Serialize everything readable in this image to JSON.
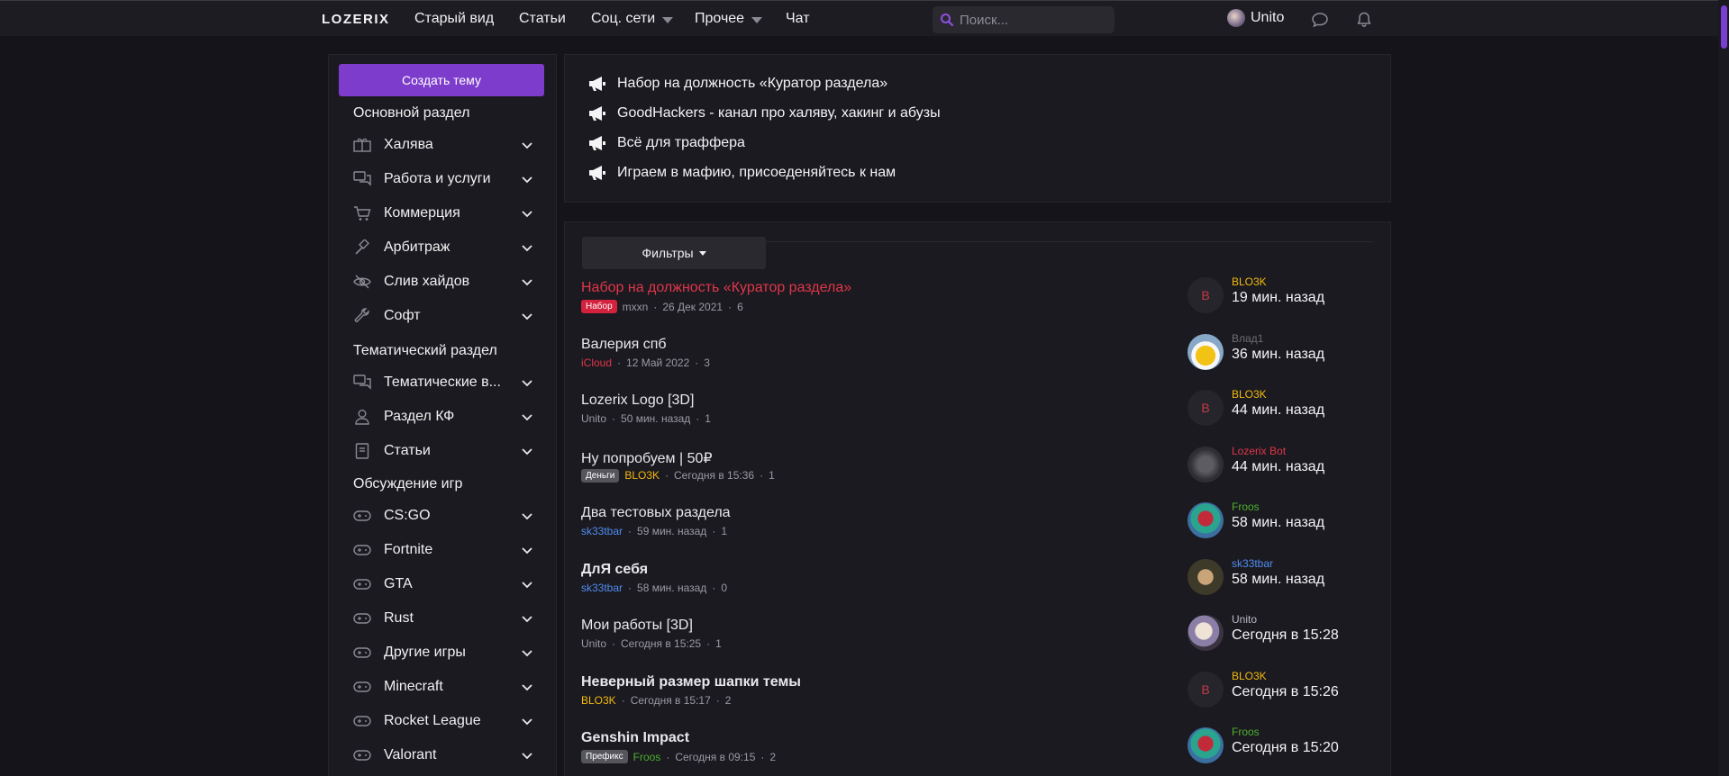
{
  "topnav": {
    "logo": "LOZERIX",
    "links": [
      "Старый вид",
      "Статьи",
      "Соц. сети",
      "Прочее",
      "Чат"
    ],
    "search_placeholder": "Поиск...",
    "username": "Unito"
  },
  "sidebar": {
    "create_button": "Создать тему",
    "sections": [
      {
        "title": "Основной раздел",
        "items": [
          {
            "label": "Халява",
            "icon": "gift-icon"
          },
          {
            "label": "Работа и услуги",
            "icon": "chat-icon"
          },
          {
            "label": "Коммерция",
            "icon": "cart-icon"
          },
          {
            "label": "Арбитраж",
            "icon": "hammer-icon"
          },
          {
            "label": "Слив хайдов",
            "icon": "eye-slash-icon"
          },
          {
            "label": "Софт",
            "icon": "wrench-icon"
          }
        ]
      },
      {
        "title": "Тематический раздел",
        "items": [
          {
            "label": "Тематические в...",
            "icon": "chat-icon"
          },
          {
            "label": "Раздел КФ",
            "icon": "user-icon"
          },
          {
            "label": "Статьи",
            "icon": "book-icon"
          }
        ]
      },
      {
        "title": "Обсуждение игр",
        "items": [
          {
            "label": "CS:GO",
            "icon": "gamepad-icon"
          },
          {
            "label": "Fortnite",
            "icon": "gamepad-icon"
          },
          {
            "label": "GTA",
            "icon": "gamepad-icon"
          },
          {
            "label": "Rust",
            "icon": "gamepad-icon"
          },
          {
            "label": "Другие игры",
            "icon": "gamepad-icon"
          },
          {
            "label": "Minecraft",
            "icon": "gamepad-icon"
          },
          {
            "label": "Rocket League",
            "icon": "gamepad-icon"
          },
          {
            "label": "Valorant",
            "icon": "gamepad-icon"
          }
        ]
      }
    ]
  },
  "announcements": [
    "Набор на должность «Куратор раздела»",
    "GoodHackers - канал про халяву, хакинг и абузы",
    "Всё для траффера",
    "Играем в мафию, присоеденяйтесь к нам"
  ],
  "threads": {
    "filters_label": "Фильтры",
    "items": [
      {
        "title": "Набор на должность «Куратор раздела»",
        "title_color": "#e0364a",
        "bold": false,
        "prefix": "Набор",
        "prefix_color": "#d4213d",
        "author": "mxxn",
        "author_color": "#9a9aa3",
        "date": "26 Дек 2021",
        "replies": "6",
        "last_user": "BLO3K",
        "last_user_color": "#f2b90f",
        "last_time": "19 мин. назад",
        "avatar_letter": "B",
        "avatar_type": "letter"
      },
      {
        "title": "Валерия спб",
        "title_color": "#e8e8ec",
        "bold": false,
        "prefix": "",
        "prefix_color": "",
        "author": "iCloud",
        "author_color": "#e0364a",
        "date": "12 Май 2022",
        "replies": "3",
        "last_user": "Влад1",
        "last_user_color": "#6d6d75",
        "last_time": "36 мин. назад",
        "avatar_letter": "",
        "avatar_type": "car"
      },
      {
        "title": "Lozerix Logo [3D]",
        "title_color": "#e8e8ec",
        "bold": false,
        "prefix": "",
        "prefix_color": "",
        "author": "Unito",
        "author_color": "#9a9aa3",
        "date": "50 мин. назад",
        "replies": "1",
        "last_user": "BLO3K",
        "last_user_color": "#f2b90f",
        "last_time": "44 мин. назад",
        "avatar_letter": "B",
        "avatar_type": "letter"
      },
      {
        "title": "Ну попробуем | 50₽",
        "title_color": "#e8e8ec",
        "bold": false,
        "prefix": "Деньги",
        "prefix_color": "#55555c",
        "author": "BLO3K",
        "author_color": "#f2b90f",
        "date": "Сегодня в 15:36",
        "replies": "1",
        "last_user": "Lozerix Bot",
        "last_user_color": "#e0364a",
        "last_time": "44 мин. назад",
        "avatar_letter": "",
        "avatar_type": "bot"
      },
      {
        "title": "Два тестовых раздела",
        "title_color": "#e8e8ec",
        "bold": false,
        "prefix": "",
        "prefix_color": "",
        "author": "sk33tbar",
        "author_color": "#4f8cf0",
        "date": "59 мин. назад",
        "replies": "1",
        "last_user": "Froos",
        "last_user_color": "#4caf2c",
        "last_time": "58 мин. назад",
        "avatar_letter": "",
        "avatar_type": "froos"
      },
      {
        "title": "ДлЯ себя",
        "title_color": "#e8e8ec",
        "bold": true,
        "prefix": "",
        "prefix_color": "",
        "author": "sk33tbar",
        "author_color": "#4f8cf0",
        "date": "58 мин. назад",
        "replies": "0",
        "last_user": "sk33tbar",
        "last_user_color": "#4f8cf0",
        "last_time": "58 мин. назад",
        "avatar_letter": "",
        "avatar_type": "face"
      },
      {
        "title": "Мои работы [3D]",
        "title_color": "#e8e8ec",
        "bold": false,
        "prefix": "",
        "prefix_color": "",
        "author": "Unito",
        "author_color": "#9a9aa3",
        "date": "Сегодня в 15:25",
        "replies": "1",
        "last_user": "Unito",
        "last_user_color": "#b9b9c2",
        "last_time": "Сегодня в 15:28",
        "avatar_letter": "",
        "avatar_type": "unito"
      },
      {
        "title": "Неверный размер шапки темы",
        "title_color": "#e8e8ec",
        "bold": true,
        "prefix": "",
        "prefix_color": "",
        "author": "BLO3K",
        "author_color": "#f2b90f",
        "date": "Сегодня в 15:17",
        "replies": "2",
        "last_user": "BLO3K",
        "last_user_color": "#f2b90f",
        "last_time": "Сегодня в 15:26",
        "avatar_letter": "B",
        "avatar_type": "letter"
      },
      {
        "title": "Genshin Impact",
        "title_color": "#e8e8ec",
        "bold": true,
        "prefix": "Префикс",
        "prefix_color": "#55555c",
        "author": "Froos",
        "author_color": "#4caf2c",
        "date": "Сегодня в 09:15",
        "replies": "2",
        "last_user": "Froos",
        "last_user_color": "#4caf2c",
        "last_time": "Сегодня в 15:20",
        "avatar_letter": "",
        "avatar_type": "froos"
      }
    ]
  },
  "colors": {
    "accent": "#7d3ccc",
    "background": "#15141a",
    "panel": "#1b1a20"
  }
}
